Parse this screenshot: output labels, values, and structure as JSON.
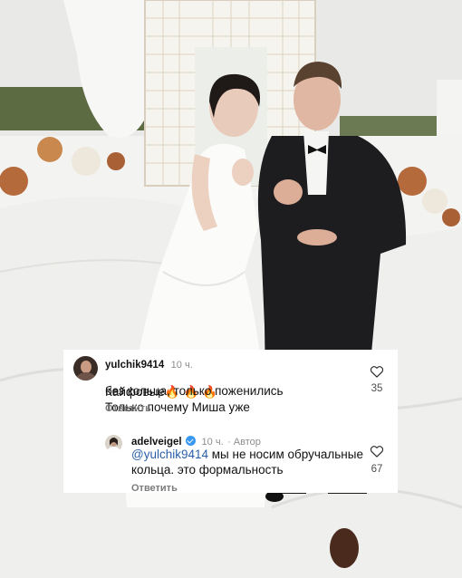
{
  "colors": {
    "mention": "#2a5fa8",
    "verified_badge": "#3897f0",
    "card_bg": "#ffffff"
  },
  "photo": {
    "description_icon": "wedding-photo"
  },
  "comment": {
    "username": "yulchik9414",
    "time": "10 ч.",
    "text_part1": "Кайфовые",
    "emoji": "🔥 🔥 🔥",
    "text_part2": "Только почему Миша уже",
    "text_line2": "без кольца, только поженились",
    "like_count": "35",
    "reply_label": "Ответить"
  },
  "reply": {
    "username": "adelveigel",
    "time": "10 ч.",
    "author_label": "· Автор",
    "mention": "@yulchik9414",
    "text_line1": " мы не носим обручальные",
    "text_line2": "кольца. это формальность",
    "like_count": "67",
    "reply_label": "Ответить"
  }
}
